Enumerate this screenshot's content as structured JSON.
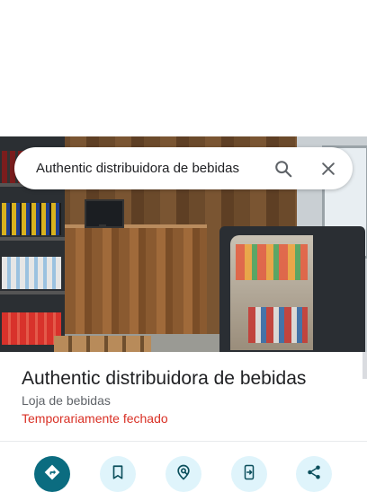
{
  "search": {
    "query": "Authentic distribuidora de bebidas",
    "search_icon": "search-icon",
    "close_icon": "close-icon"
  },
  "photo": {
    "description_icon": "store-photo"
  },
  "place": {
    "title": "Authentic distribuidora de bebidas",
    "category": "Loja de bebidas",
    "status": "Temporariamente fechado"
  },
  "actions": [
    {
      "icon": "directions-icon"
    },
    {
      "icon": "bookmark-icon"
    },
    {
      "icon": "nearby-icon"
    },
    {
      "icon": "send-to-phone-icon"
    },
    {
      "icon": "share-icon"
    }
  ],
  "colors": {
    "status_red": "#d93025",
    "primary_action": "#0b6c80",
    "action_bg": "#dff4fb"
  }
}
